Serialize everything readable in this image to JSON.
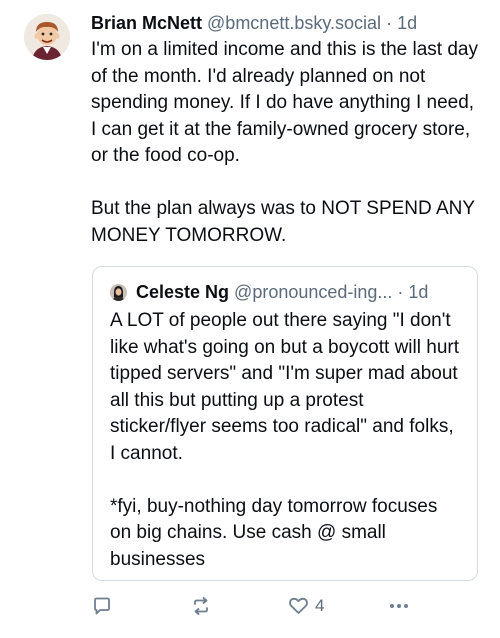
{
  "post": {
    "author": {
      "display_name": "Brian McNett",
      "handle": "@bmcnett.bsky.social",
      "separator": "·",
      "time": "1d"
    },
    "text": "I'm on a limited income and this is the last day of the month. I'd already planned on not spending money. If I do have anything I need, I can get it at the family-owned grocery store, or the food co-op.\n\nBut the plan always was to NOT SPEND ANY MONEY TOMORROW.",
    "quote": {
      "display_name": "Celeste Ng",
      "handle": "@pronounced-ing...",
      "separator": "·",
      "time": "1d",
      "text": "A LOT of people out there saying \"I don't like what's going on but a boycott will hurt tipped servers\" and \"I'm super mad about all this but putting up a protest sticker/flyer seems too radical\" and folks, I cannot.\n\n*fyi, buy-nothing day tomorrow focuses on big chains. Use cash @ small businesses"
    },
    "actions": {
      "reply_icon": "reply-icon",
      "repost_icon": "repost-icon",
      "like_icon": "heart-icon",
      "like_count": "4",
      "more_icon": "more-icon"
    }
  }
}
